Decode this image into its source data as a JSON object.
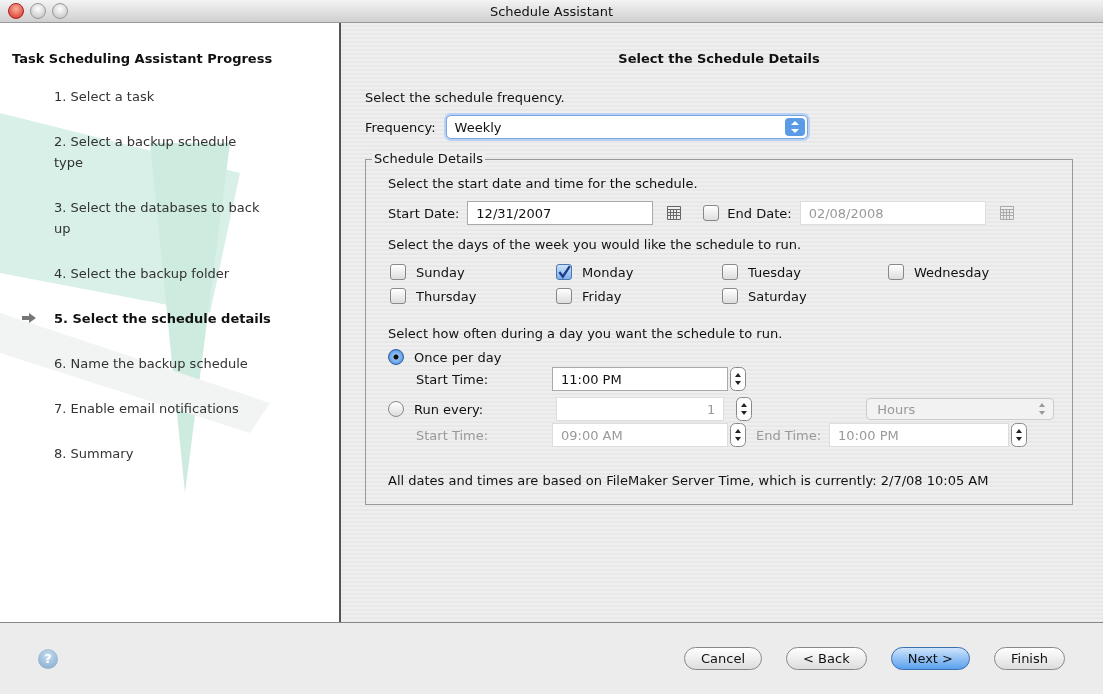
{
  "window": {
    "title": "Schedule Assistant"
  },
  "sidebar": {
    "title": "Task Scheduling Assistant Progress",
    "steps": [
      {
        "label": "1. Select a task",
        "selected": false
      },
      {
        "label": "2. Select a backup schedule type",
        "selected": false
      },
      {
        "label": "3. Select the databases to back up",
        "selected": false
      },
      {
        "label": "4. Select the backup folder",
        "selected": false
      },
      {
        "label": "5. Select the schedule details",
        "selected": true
      },
      {
        "label": "6. Name the backup schedule",
        "selected": false
      },
      {
        "label": "7. Enable email notifications",
        "selected": false
      },
      {
        "label": "8. Summary",
        "selected": false
      }
    ]
  },
  "panel": {
    "title": "Select the Schedule Details",
    "intro": "Select the schedule frequency.",
    "frequency": {
      "label": "Frequency:",
      "value": "Weekly"
    },
    "details": {
      "legend": "Schedule Details",
      "date_prompt": "Select the start date and time for the schedule.",
      "start_date": {
        "label": "Start Date:",
        "value": "12/31/2007"
      },
      "end_date": {
        "label": "End Date:",
        "value": "02/08/2008",
        "checked": false
      },
      "days_prompt": "Select the days of the week you would like the schedule to run.",
      "days": [
        {
          "label": "Sunday",
          "checked": false
        },
        {
          "label": "Monday",
          "checked": true
        },
        {
          "label": "Tuesday",
          "checked": false
        },
        {
          "label": "Wednesday",
          "checked": false
        },
        {
          "label": "Thursday",
          "checked": false
        },
        {
          "label": "Friday",
          "checked": false
        },
        {
          "label": "Saturday",
          "checked": false
        }
      ],
      "often_prompt": "Select how often during a day you want the schedule to run.",
      "once": {
        "label": "Once per day",
        "selected": true,
        "start_label": "Start Time:",
        "start_value": "11:00 PM"
      },
      "every": {
        "label": "Run every:",
        "selected": false,
        "value": "1",
        "unit": "Hours",
        "start_label": "Start Time:",
        "start_value": "09:00 AM",
        "end_label": "End Time:",
        "end_value": "10:00 PM"
      },
      "note": "All dates and times are based on FileMaker Server Time, which is currently: 2/7/08 10:05 AM"
    }
  },
  "footer": {
    "help": "?",
    "buttons": [
      {
        "label": "Cancel",
        "default": false
      },
      {
        "label": "< Back",
        "default": false
      },
      {
        "label": "Next >",
        "default": true
      },
      {
        "label": "Finish",
        "default": false
      }
    ]
  }
}
